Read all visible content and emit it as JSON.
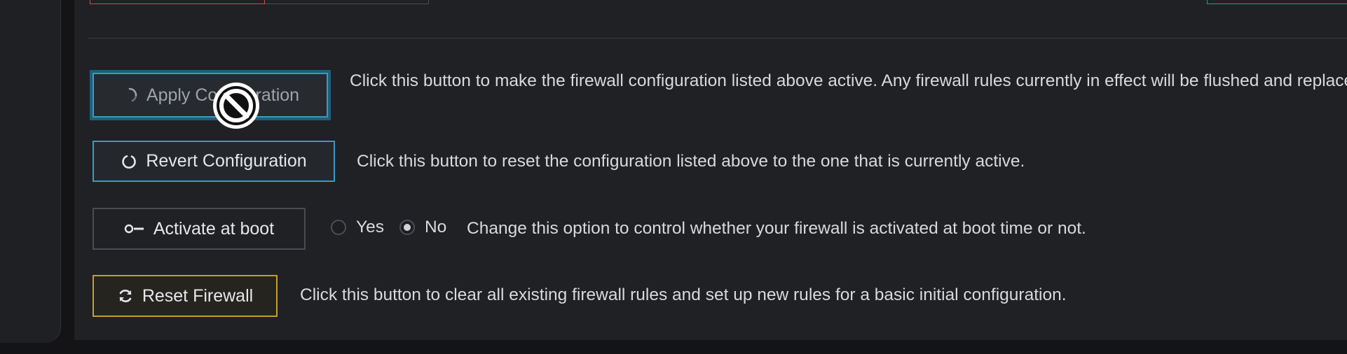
{
  "apply": {
    "label": "Apply Configuration",
    "description": "Click this button to make the firewall configuration listed above active. Any firewall rules currently in effect will be flushed and replaced"
  },
  "revert": {
    "label": "Revert Configuration",
    "description": "Click this button to reset the configuration listed above to the one that is currently active."
  },
  "boot": {
    "label": "Activate at boot",
    "options": [
      "Yes",
      "No"
    ],
    "selected": "No",
    "description": "Change this option to control whether your firewall is activated at boot time or not."
  },
  "reset": {
    "label": "Reset Firewall",
    "description": "Click this button to clear all existing firewall rules and set up new rules for a basic initial configuration."
  },
  "colors": {
    "info_border": "#3a9bbf",
    "warning_border": "#c79d2e",
    "danger_border": "#c0504d",
    "success_border": "#1e9e7c"
  },
  "icons": {
    "apply": "spinner-icon",
    "revert": "circle-arrow-icon",
    "boot": "toggle-key-icon",
    "reset": "refresh-icon",
    "cursor": "not-allowed-cursor-icon"
  }
}
